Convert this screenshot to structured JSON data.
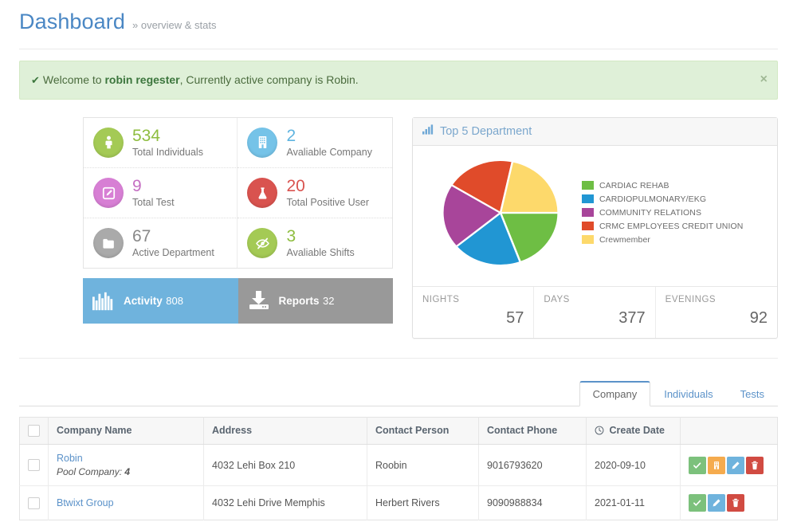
{
  "header": {
    "title": "Dashboard",
    "subtitle": "» overview & stats"
  },
  "alert": {
    "check_icon": "check-icon",
    "prefix": "Welcome to ",
    "user": "robin regester",
    "suffix": ", Currently active company is Robin.",
    "close_label": "×",
    "bg_color": "#dff0d8",
    "text_color": "#3c763d"
  },
  "stats": [
    {
      "value": "534",
      "label": "Total Individuals",
      "icon": "person-icon",
      "color": "#a4ca55",
      "num_color": "#8ebd3f"
    },
    {
      "value": "2",
      "label": "Avaliable Company",
      "icon": "building-icon",
      "color": "#75c3e8",
      "num_color": "#5fb4e0"
    },
    {
      "value": "9",
      "label": "Total Test",
      "icon": "pencil-square-icon",
      "color": "#d77fd4",
      "num_color": "#c56fc2"
    },
    {
      "value": "20",
      "label": "Total Positive User",
      "icon": "flask-icon",
      "color": "#d9534f",
      "num_color": "#d9534f"
    },
    {
      "value": "67",
      "label": "Active Department",
      "icon": "folder-icon",
      "color": "#aaaaaa",
      "num_color": "#888888"
    },
    {
      "value": "3",
      "label": "Avaliable Shifts",
      "icon": "eye-slash-icon",
      "color": "#a4ca55",
      "num_color": "#8ebd3f"
    }
  ],
  "tiles": [
    {
      "name": "Activity",
      "value": "808",
      "icon": "bar-chart-icon",
      "color": "#6fb3dd"
    },
    {
      "name": "Reports",
      "value": "32",
      "icon": "download-icon",
      "color": "#999999"
    }
  ],
  "panel": {
    "icon": "bar-chart-icon",
    "title": "Top 5 Department"
  },
  "chart_data": {
    "type": "pie",
    "title": "Top 5 Department",
    "labels": [
      "CARDIAC REHAB",
      "CARDIOPULMONARY/EKG",
      "COMMUNITY RELATIONS",
      "CRMC EMPLOYEES CREDIT UNION",
      "Crewmember"
    ],
    "values": [
      19.5,
      19.5,
      20,
      19.5,
      21.5
    ],
    "colors": [
      "#6ebe44",
      "#2196d3",
      "#a8459a",
      "#e04b2a",
      "#fdd96b"
    ],
    "start_angle": 90,
    "direction": "clockwise",
    "legend_position": "right"
  },
  "panel_footer": [
    {
      "label": "NIGHTS",
      "value": "57"
    },
    {
      "label": "DAYS",
      "value": "377"
    },
    {
      "label": "EVENINGS",
      "value": "92"
    }
  ],
  "tabs": [
    {
      "label": "Company",
      "active": true
    },
    {
      "label": "Individuals",
      "active": false
    },
    {
      "label": "Tests",
      "active": false
    }
  ],
  "table": {
    "select_all_name": "select-all-checkbox",
    "columns": [
      "Company Name",
      "Address",
      "Contact Person",
      "Contact Phone",
      "Create Date"
    ],
    "create_date_icon": "clock-icon",
    "rows": [
      {
        "company": "Robin",
        "sublabel_text": "Pool Company: ",
        "sublabel_value": "4",
        "address": "4032 Lehi Box 210",
        "contact_person": "Roobin",
        "contact_phone": "9016793620",
        "create_date": "2020-09-10",
        "actions": [
          {
            "icon": "check-icon",
            "color": "#7cc17c"
          },
          {
            "icon": "building-icon",
            "color": "#f5ab4e"
          },
          {
            "icon": "pencil-icon",
            "color": "#6fb3dd"
          },
          {
            "icon": "trash-icon",
            "color": "#d14b42"
          }
        ]
      },
      {
        "company": "Btwixt Group",
        "sublabel_text": "",
        "sublabel_value": "",
        "address": "4032 Lehi Drive Memphis",
        "contact_person": "Herbert Rivers",
        "contact_phone": "9090988834",
        "create_date": "2021-01-11",
        "actions": [
          {
            "icon": "check-icon",
            "color": "#7cc17c"
          },
          {
            "icon": "pencil-icon",
            "color": "#6fb3dd"
          },
          {
            "icon": "trash-icon",
            "color": "#d14b42"
          }
        ]
      }
    ]
  }
}
